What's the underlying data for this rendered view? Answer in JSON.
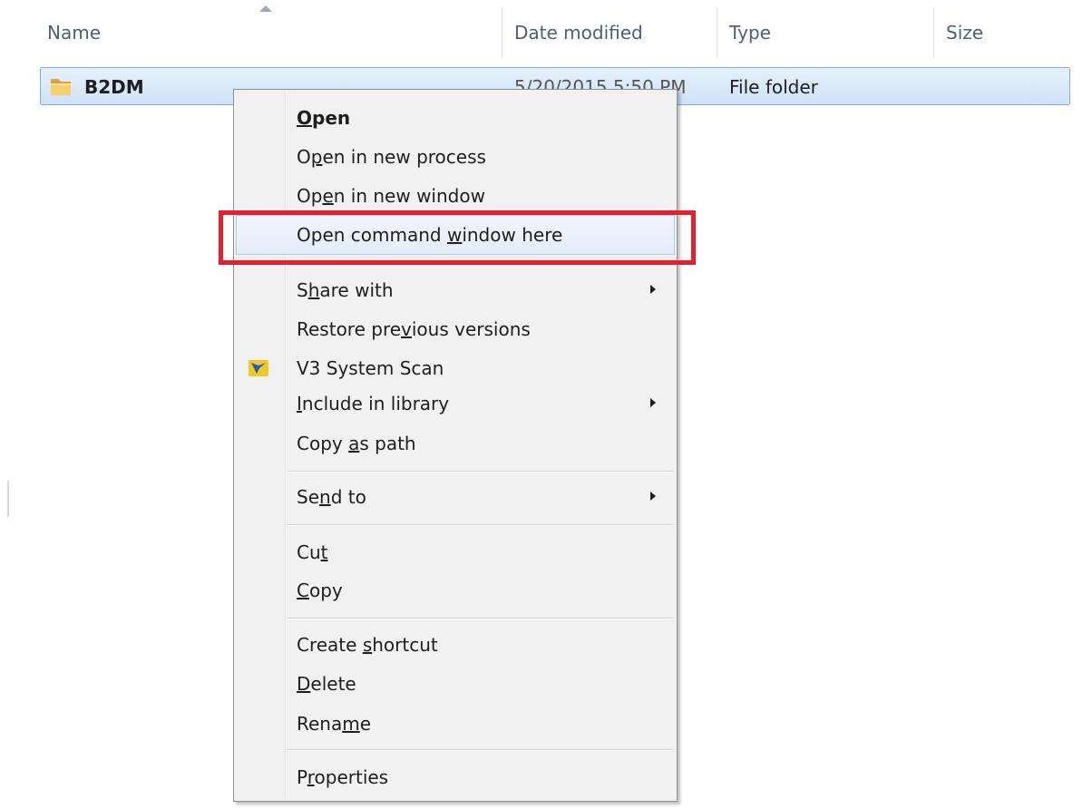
{
  "columns": {
    "name": "Name",
    "date_modified": "Date modified",
    "type": "Type",
    "size": "Size"
  },
  "file_row": {
    "name": "B2DM",
    "date_modified": "5/20/2015 5:50 PM",
    "type": "File folder",
    "icon": "folder-icon"
  },
  "context_menu": {
    "items": [
      {
        "label": "Open",
        "accesskey": "O",
        "bold": true
      },
      {
        "label": "Open in new process",
        "accesskey": "p"
      },
      {
        "label": "Open in new window",
        "accesskey": "e"
      },
      {
        "label": "Open command window here",
        "accesskey": "w",
        "highlighted": true
      },
      {
        "label": "Share with",
        "accesskey": "h",
        "submenu": true
      },
      {
        "label": "Restore previous versions",
        "accesskey": "v"
      },
      {
        "label": "V3 System Scan",
        "icon": "v3-scan-icon"
      },
      {
        "label": "Include in library",
        "accesskey": "I",
        "submenu": true
      },
      {
        "label": "Copy as path",
        "accesskey": "a"
      },
      {
        "label": "Send to",
        "accesskey": "n",
        "submenu": true
      },
      {
        "label": "Cut",
        "accesskey": "t"
      },
      {
        "label": "Copy",
        "accesskey": "C"
      },
      {
        "label": "Create shortcut",
        "accesskey": "s"
      },
      {
        "label": "Delete",
        "accesskey": "D"
      },
      {
        "label": "Rename",
        "accesskey": "m"
      },
      {
        "label": "Properties",
        "accesskey": "r"
      }
    ]
  },
  "colors": {
    "highlight_box": "#e5202c",
    "selection": "#cfe1f6",
    "menu_background": "#f1f1f1"
  }
}
